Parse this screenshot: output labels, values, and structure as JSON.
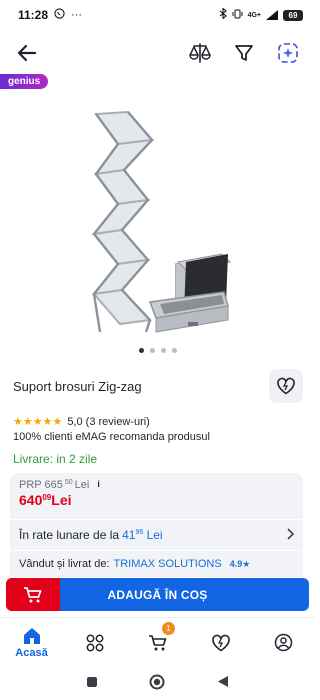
{
  "status_bar": {
    "time": "11:28",
    "overflow": "···",
    "network": "4G+",
    "battery": "69"
  },
  "badge": {
    "label": "genius"
  },
  "product": {
    "title": "Suport brosuri Zig-zag",
    "rating_stars": "★★★★★",
    "rating": "5,0 (3 review-uri)",
    "recommend": "100% clienti eMAG recomanda produsul",
    "delivery": "Livrare: in 2 zile"
  },
  "price": {
    "prp_label": "PRP 665",
    "prp_decimals": "50",
    "prp_currency": " Lei",
    "info_icon": "i",
    "current_main": "640",
    "current_decimals": "09",
    "current_currency": " Lei"
  },
  "installments": {
    "label": "În rate lunare de la",
    "value_main": "41",
    "value_decimals": "96",
    "value_currency": " Lei"
  },
  "seller": {
    "label": "Vândut și livrat de:",
    "name": "TRIMAX SOLUTIONS",
    "score": "4.9★"
  },
  "cta": {
    "label": "ADAUGĂ ÎN COȘ"
  },
  "tabs": [
    {
      "label": "Acasă"
    }
  ],
  "cart_count": "1",
  "colors": {
    "accent": "#1266e3",
    "price": "#e2001a",
    "delivery": "#2f9e3b",
    "badge": "#f28a1d"
  },
  "icons": [
    "back-arrow-icon",
    "compare-icon",
    "filter-icon",
    "ai-assistant-icon",
    "heart-icon",
    "home-icon",
    "categories-icon",
    "cart-icon",
    "favorites-icon",
    "account-icon"
  ]
}
